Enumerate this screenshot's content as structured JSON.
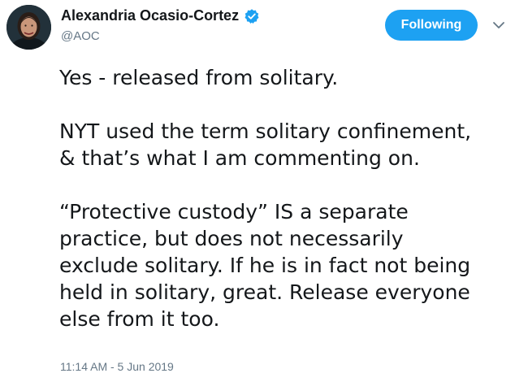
{
  "author": {
    "display_name": "Alexandria Ocasio-Cortez",
    "handle": "@AOC",
    "verified": true
  },
  "follow_button": {
    "label": "Following",
    "color": "#1da1f2"
  },
  "tweet": {
    "paragraphs": [
      [
        "Yes - released from solitary."
      ],
      [
        "NYT used the term solitary confinement,",
        "& that’s what I am commenting on."
      ],
      [
        "“Protective custody” IS a separate",
        "practice, but does not necessarily",
        "exclude solitary. If he is in fact not being",
        "held in solitary, great. Release everyone",
        "else from it too."
      ]
    ],
    "timestamp": "11:14 AM - 5 Jun 2019"
  },
  "icons": [
    "avatar",
    "verified-badge-icon",
    "chevron-down-icon"
  ]
}
